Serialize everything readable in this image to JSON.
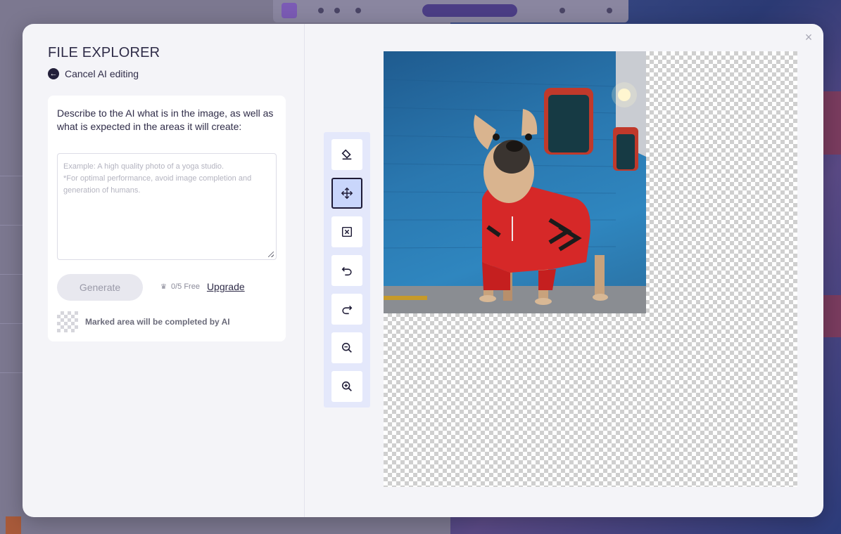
{
  "modal": {
    "title": "FILE EXPLORER",
    "cancel_label": "Cancel AI editing",
    "close_icon": "×"
  },
  "prompt_card": {
    "description": "Describe to the AI what is in the image, as well as what is expected in the areas it will create:",
    "prompt_value": "",
    "prompt_placeholder": "Example: A high quality photo of a yoga studio.\n*For optimal performance, avoid image completion and generation of humans.",
    "generate_label": "Generate",
    "free_count": "0/5 Free",
    "upgrade_label": "Upgrade",
    "legend_text": "Marked area will be completed by AI"
  },
  "tools": [
    {
      "icon": "eraser-icon",
      "active": false
    },
    {
      "icon": "move-icon",
      "active": true
    },
    {
      "icon": "clear-box-icon",
      "active": false
    },
    {
      "icon": "undo-icon",
      "active": false
    },
    {
      "icon": "redo-icon",
      "active": false
    },
    {
      "icon": "zoom-out-icon",
      "active": false
    },
    {
      "icon": "zoom-in-icon",
      "active": false
    }
  ],
  "colors": {
    "accent_active": "#c9d6fb",
    "text_dark": "#2f2c48",
    "tool_strip": "#e4e8fb"
  }
}
